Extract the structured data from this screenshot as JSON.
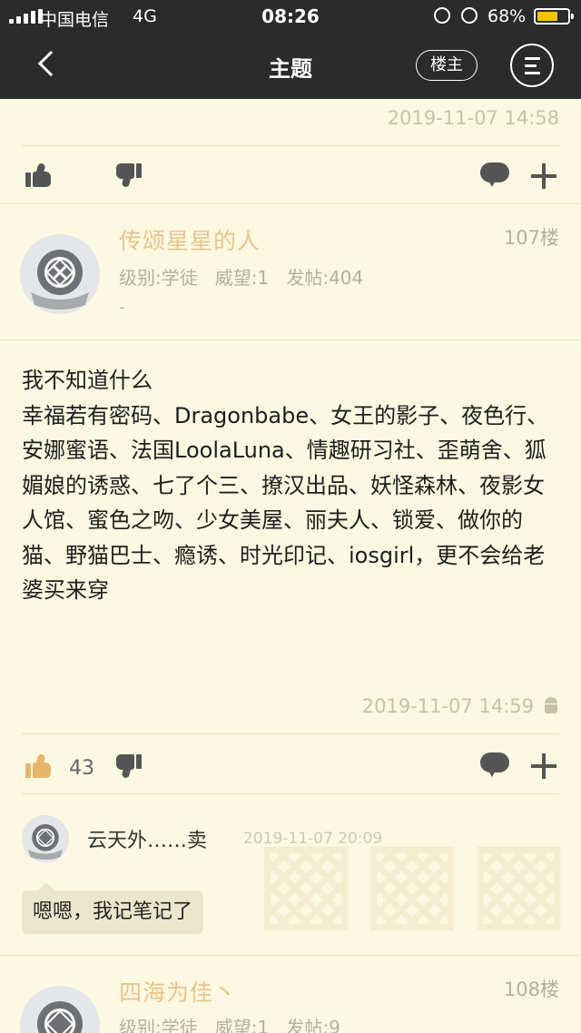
{
  "status_bar": {
    "carrier": "中国电信",
    "network": "4G",
    "time": "08:26",
    "battery": "68%",
    "battery_level": 0.68,
    "battery_color": "#f5c400"
  },
  "nav": {
    "title": "主题",
    "op_button": "楼主",
    "back_icon": "chevron-left-icon",
    "menu_icon": "menu-icon"
  },
  "colors": {
    "background": "#fdf8e1",
    "header": "#2b2b2b",
    "username": "#e9c48a",
    "like_active": "#e8b66b"
  },
  "prev_post": {
    "time": "2019-11-07 14:58"
  },
  "posts": [
    {
      "username": "传颂星星的人",
      "floor": "107楼",
      "meta": "级别:学徒   威望:1   发帖:404",
      "signature": "-",
      "body": "我不知道什么\n幸福若有密码、Dragonbabe、女王的影子、夜色行、安娜蜜语、法国LoolaLuna、情趣研习社、歪萌舍、狐媚娘的诱惑、七了个三、撩汉出品、妖怪森林、夜影女人馆、蜜色之吻、少女美屋、丽夫人、锁爱、做你的猫、野猫巴士、瘾诱、时光印记、iosgirl，更不会给老婆买来穿",
      "time": "2019-11-07 14:59",
      "likes": "43",
      "reply": {
        "username": "云天外……卖",
        "time": "2019-11-07 20:09",
        "text": "嗯嗯，我记笔记了"
      }
    },
    {
      "username": "四海为佳丶",
      "floor": "108楼",
      "meta": "级别:学徒   威望:1   发帖:9"
    }
  ]
}
